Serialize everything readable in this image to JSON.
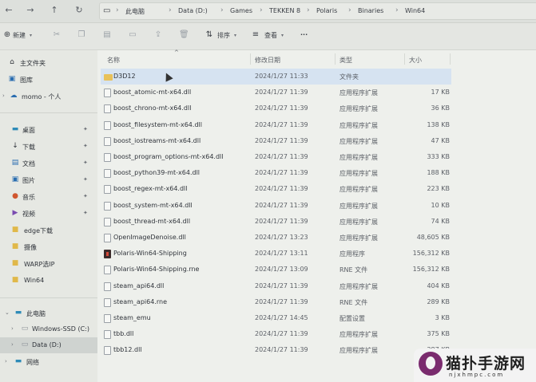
{
  "address_bar": {
    "crumbs": [
      "此电脑",
      "Data (D:)",
      "Games",
      "TEKKEN 8",
      "Polaris",
      "Binaries",
      "Win64"
    ]
  },
  "toolbar": {
    "new_label": "新建",
    "sort_label": "排序",
    "view_label": "查看",
    "more_label": "···"
  },
  "sidebar": {
    "home": "主文件夹",
    "gallery": "图库",
    "onedrive": "momo - 个人",
    "pinned": [
      "桌面",
      "下载",
      "文档",
      "图片",
      "音乐",
      "视频"
    ],
    "folders": [
      "edge下载",
      "摄像",
      "WARP选IP",
      "Win64"
    ],
    "this_pc": "此电脑",
    "drives": [
      "Windows-SSD (C:)",
      "Data (D:)"
    ],
    "network": "网络"
  },
  "columns": {
    "name": "名称",
    "date": "修改日期",
    "type": "类型",
    "size": "大小"
  },
  "files": [
    {
      "name": "D3D12",
      "date": "2024/1/27 11:33",
      "type": "文件夹",
      "size": "",
      "kind": "folder"
    },
    {
      "name": "boost_atomic-mt-x64.dll",
      "date": "2024/1/27 11:39",
      "type": "应用程序扩展",
      "size": "17 KB",
      "kind": "file"
    },
    {
      "name": "boost_chrono-mt-x64.dll",
      "date": "2024/1/27 11:39",
      "type": "应用程序扩展",
      "size": "36 KB",
      "kind": "file"
    },
    {
      "name": "boost_filesystem-mt-x64.dll",
      "date": "2024/1/27 11:39",
      "type": "应用程序扩展",
      "size": "138 KB",
      "kind": "file"
    },
    {
      "name": "boost_iostreams-mt-x64.dll",
      "date": "2024/1/27 11:39",
      "type": "应用程序扩展",
      "size": "47 KB",
      "kind": "file"
    },
    {
      "name": "boost_program_options-mt-x64.dll",
      "date": "2024/1/27 11:39",
      "type": "应用程序扩展",
      "size": "333 KB",
      "kind": "file"
    },
    {
      "name": "boost_python39-mt-x64.dll",
      "date": "2024/1/27 11:39",
      "type": "应用程序扩展",
      "size": "188 KB",
      "kind": "file"
    },
    {
      "name": "boost_regex-mt-x64.dll",
      "date": "2024/1/27 11:39",
      "type": "应用程序扩展",
      "size": "223 KB",
      "kind": "file"
    },
    {
      "name": "boost_system-mt-x64.dll",
      "date": "2024/1/27 11:39",
      "type": "应用程序扩展",
      "size": "10 KB",
      "kind": "file"
    },
    {
      "name": "boost_thread-mt-x64.dll",
      "date": "2024/1/27 11:39",
      "type": "应用程序扩展",
      "size": "74 KB",
      "kind": "file"
    },
    {
      "name": "OpenImageDenoise.dll",
      "date": "2024/1/27 13:23",
      "type": "应用程序扩展",
      "size": "48,605 KB",
      "kind": "file"
    },
    {
      "name": "Polaris-Win64-Shipping",
      "date": "2024/1/27 13:11",
      "type": "应用程序",
      "size": "156,312 KB",
      "kind": "exe"
    },
    {
      "name": "Polaris-Win64-Shipping.rne",
      "date": "2024/1/27 13:09",
      "type": "RNE 文件",
      "size": "156,312 KB",
      "kind": "file"
    },
    {
      "name": "steam_api64.dll",
      "date": "2024/1/27 11:39",
      "type": "应用程序扩展",
      "size": "404 KB",
      "kind": "file"
    },
    {
      "name": "steam_api64.rne",
      "date": "2024/1/27 11:39",
      "type": "RNE 文件",
      "size": "289 KB",
      "kind": "file"
    },
    {
      "name": "steam_emu",
      "date": "2024/1/27 14:45",
      "type": "配置设置",
      "size": "3 KB",
      "kind": "file"
    },
    {
      "name": "tbb.dll",
      "date": "2024/1/27 11:39",
      "type": "应用程序扩展",
      "size": "375 KB",
      "kind": "file"
    },
    {
      "name": "tbb12.dll",
      "date": "2024/1/27 11:39",
      "type": "应用程序扩展",
      "size": "287 KB",
      "kind": "file"
    }
  ],
  "watermark": {
    "title": "猫扑手游网",
    "url": "njxhmpc.com"
  }
}
